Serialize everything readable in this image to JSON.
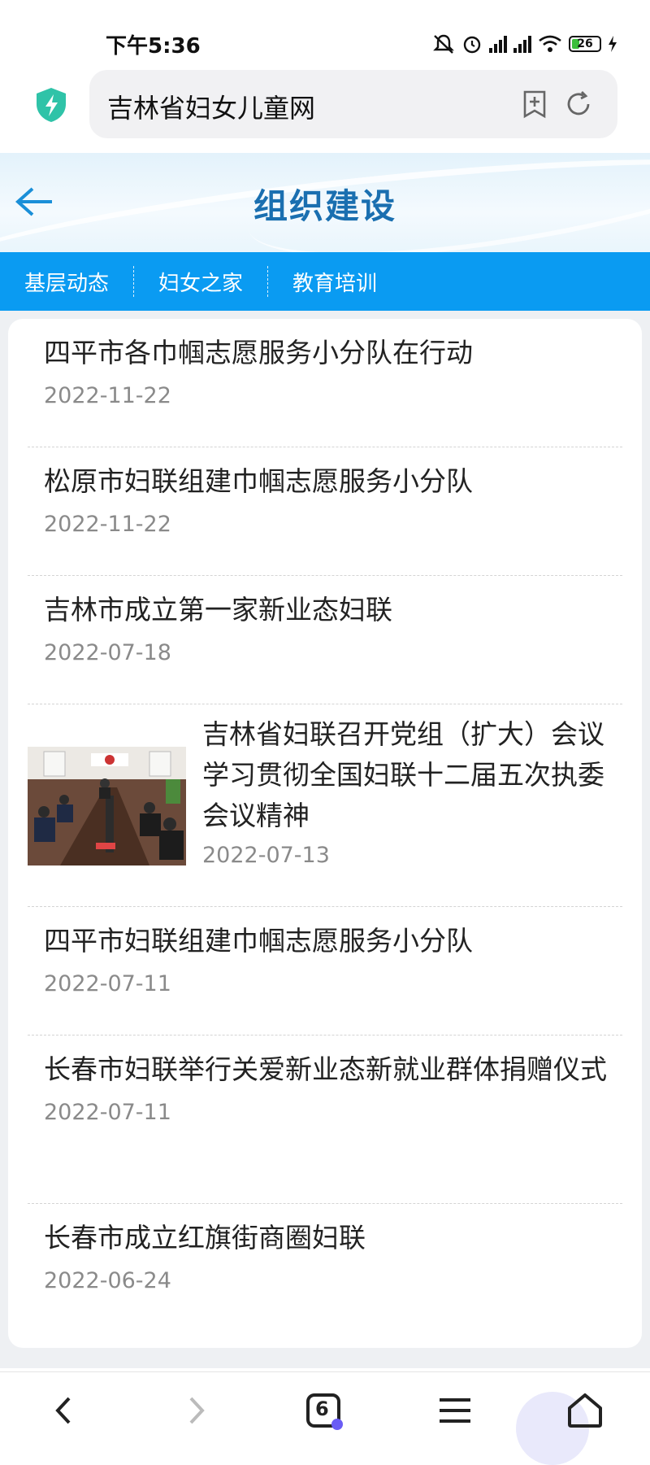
{
  "status_bar": {
    "time": "下午5:36",
    "battery": "26"
  },
  "browser": {
    "url_text": "吉林省妇女儿童网",
    "tab_count": "6"
  },
  "header": {
    "title": "组织建设"
  },
  "tabs": [
    {
      "label": "基层动态"
    },
    {
      "label": "妇女之家"
    },
    {
      "label": "教育培训"
    }
  ],
  "articles": [
    {
      "title": "四平市各巾帼志愿服务小分队在行动",
      "date": "2022-11-22"
    },
    {
      "title": "松原市妇联组建巾帼志愿服务小分队",
      "date": "2022-11-22"
    },
    {
      "title": "吉林市成立第一家新业态妇联",
      "date": "2022-07-18"
    },
    {
      "title": "吉林省妇联召开党组（扩大）会议学习贯彻全国妇联十二届五次执委会议精神",
      "date": "2022-07-13",
      "has_image": true
    },
    {
      "title": "四平市妇联组建巾帼志愿服务小分队",
      "date": "2022-07-11"
    },
    {
      "title": "长春市妇联举行关爱新业态新就业群体捐赠仪式",
      "date": "2022-07-11"
    },
    {
      "title": "长春市成立红旗街商圈妇联",
      "date": "2022-06-24"
    }
  ],
  "colors": {
    "accent": "#0a9bf2",
    "title_blue": "#1a6fb0",
    "shield_green": "#2fc3a8"
  }
}
